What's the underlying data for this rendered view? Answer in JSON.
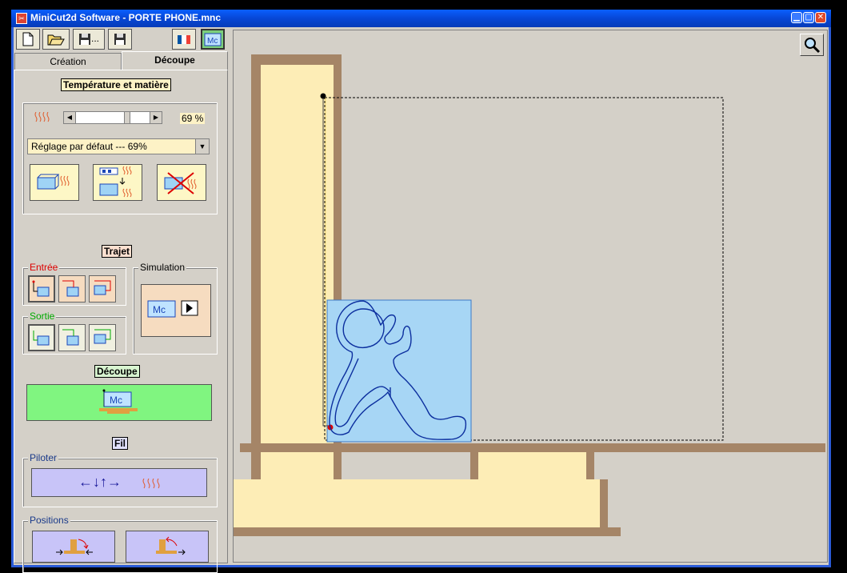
{
  "window": {
    "title": "MiniCut2d Software - PORTE PHONE.mnc",
    "buttons": [
      "_",
      "□",
      "x"
    ]
  },
  "toolbar": {
    "items": [
      "new-file",
      "open-file",
      "save-as",
      "save",
      "language-fr",
      "mc-mode"
    ],
    "save_as_label": "..."
  },
  "tabs": [
    {
      "label": "Création",
      "active": false
    },
    {
      "label": "Découpe",
      "active": true
    }
  ],
  "temperature": {
    "header": "Température et matière",
    "value": "69 %",
    "slider_fraction": 0.69,
    "preset": "Réglage par défaut --- 69%"
  },
  "trajet": {
    "header": "Trajet",
    "entree_label": "Entrée",
    "sortie_label": "Sortie",
    "simulation_label": "Simulation"
  },
  "decoupe": {
    "header": "Découpe",
    "button_text": "Mc"
  },
  "fil": {
    "header": "Fil",
    "piloter_label": "Piloter",
    "piloter_arrows": "←↓↑→",
    "positions_label": "Positions"
  },
  "colors": {
    "wood": "#a58567",
    "foam": "#fdedb6",
    "part": "#a7d6f5",
    "path": "#0b2e9e",
    "cut_button": "#80f580",
    "pilot_button": "#c8c4f8"
  }
}
